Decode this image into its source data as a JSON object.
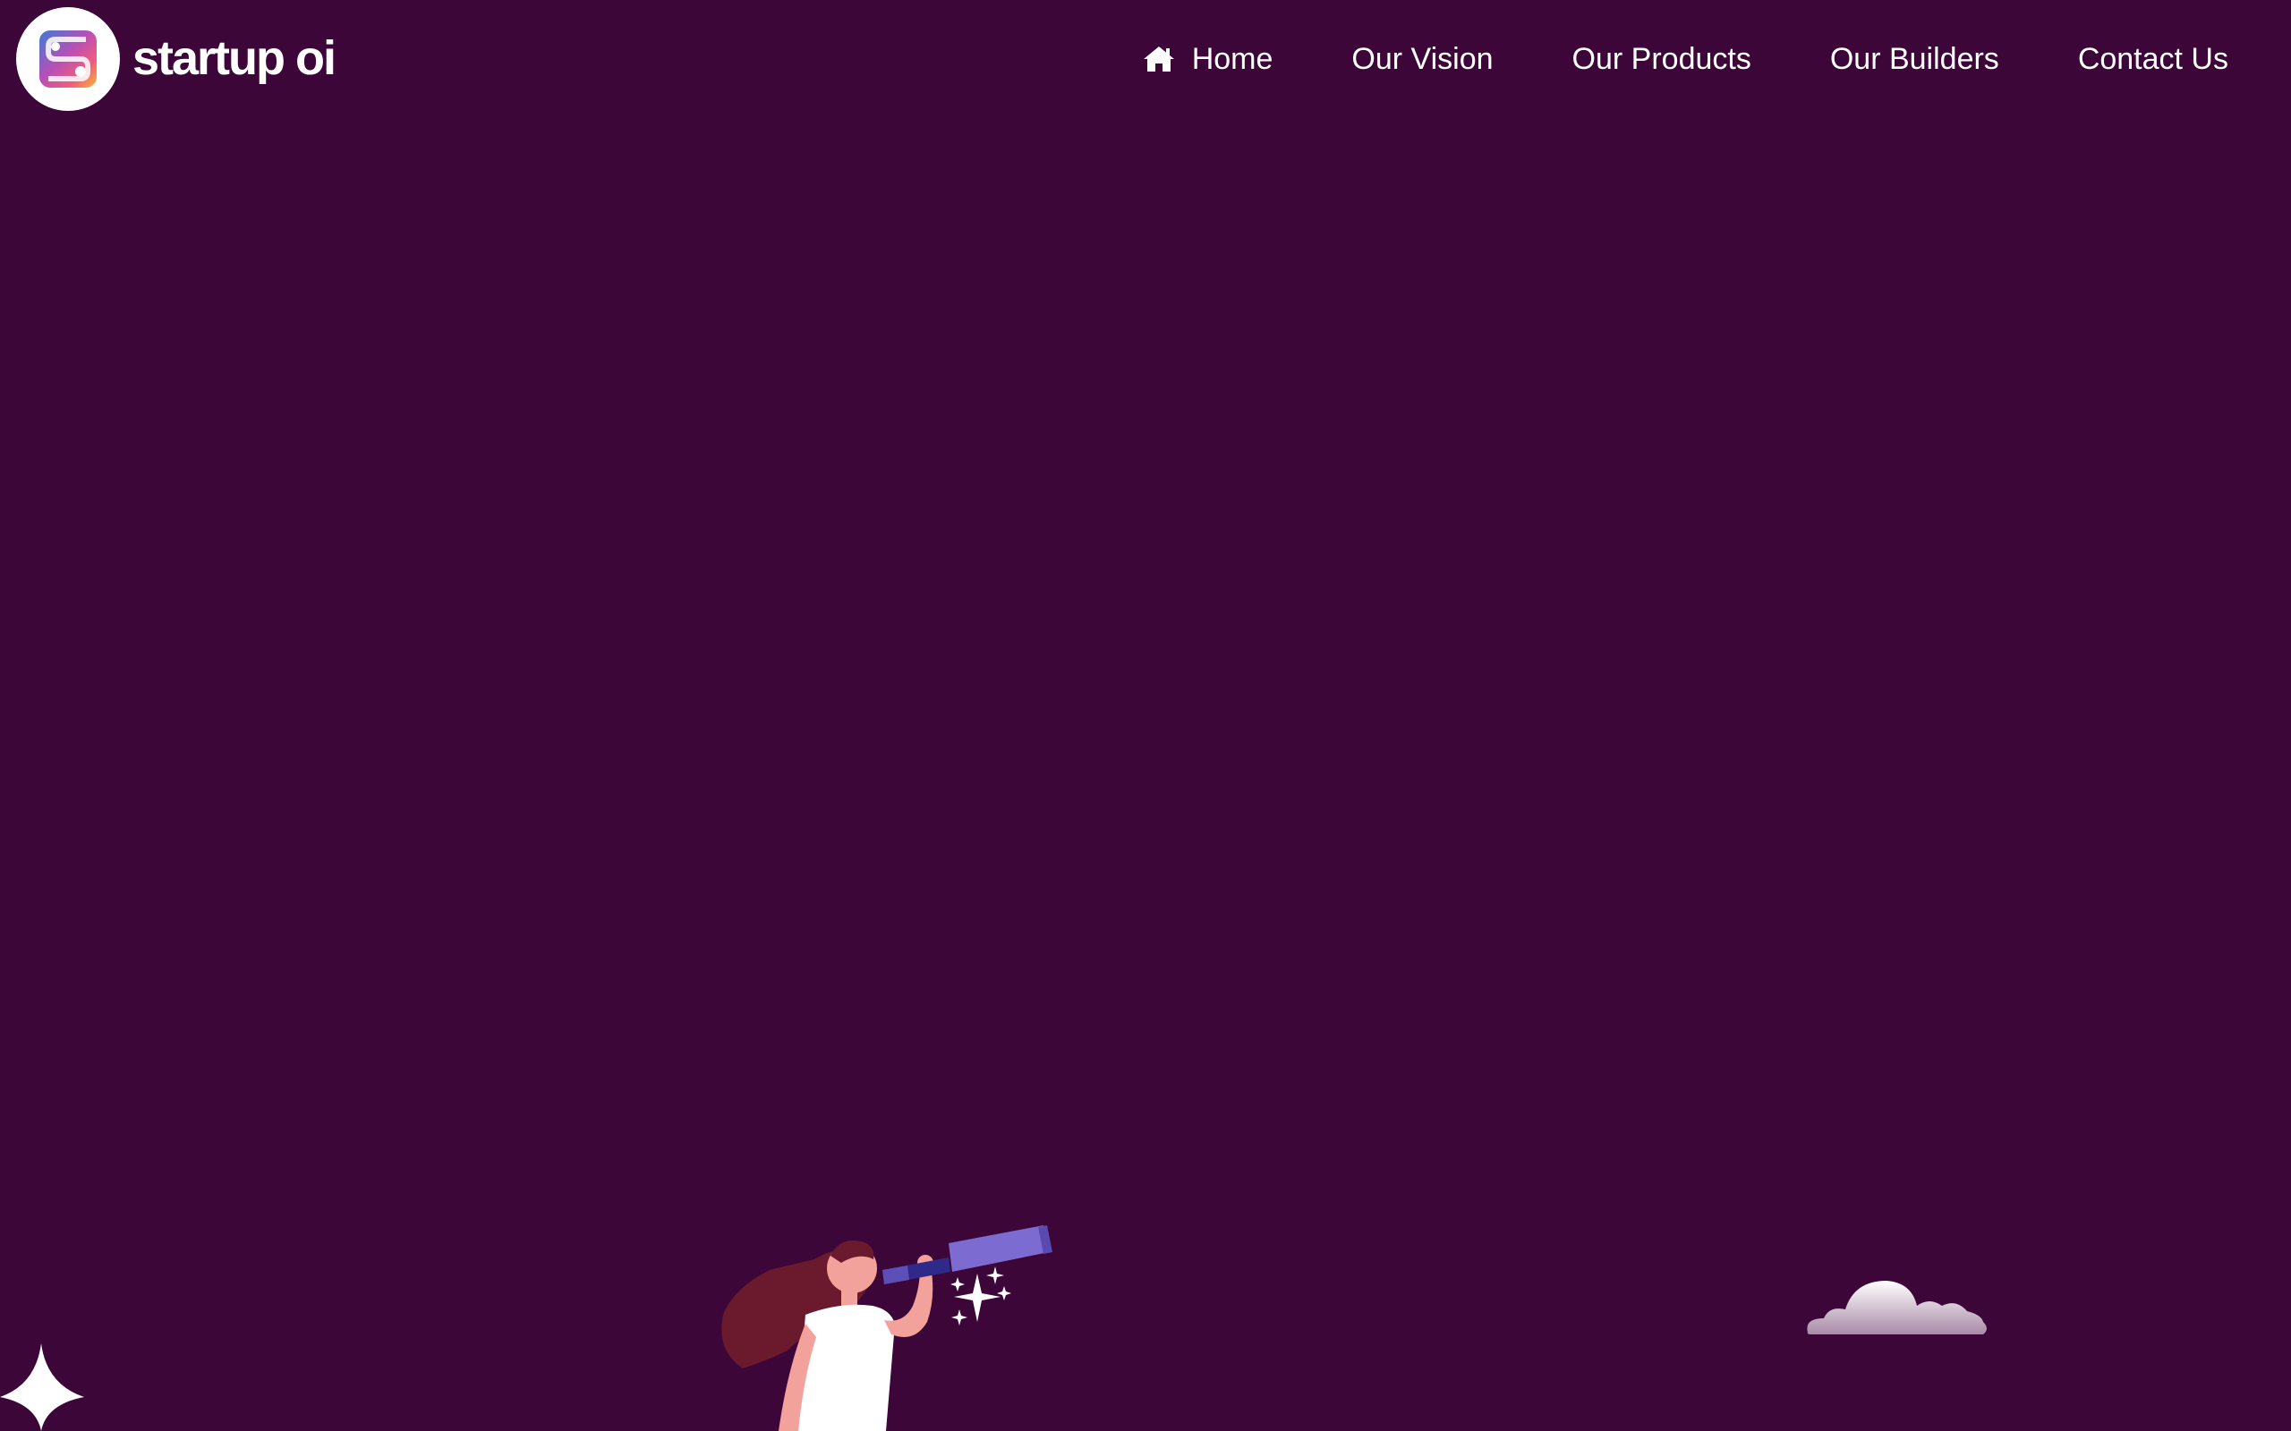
{
  "brand": {
    "name": "startup oi",
    "logo_icon": "startup-oi-logo-icon"
  },
  "nav": {
    "items": [
      {
        "label": "Home",
        "icon": "home-icon"
      },
      {
        "label": "Our Vision"
      },
      {
        "label": "Our Products"
      },
      {
        "label": "Our Builders"
      },
      {
        "label": "Contact Us"
      }
    ]
  },
  "colors": {
    "background": "#3c0738",
    "text": "#ffffff",
    "hair": "#6b1a2e",
    "skin": "#f2a29a",
    "telescope": "#7c6bd0",
    "telescope_dark": "#2f2a8a",
    "cloud": "#e9e1ec"
  },
  "illustrations": [
    "girl-with-telescope",
    "sparkle-icon",
    "cloud",
    "four-point-star-icon"
  ]
}
